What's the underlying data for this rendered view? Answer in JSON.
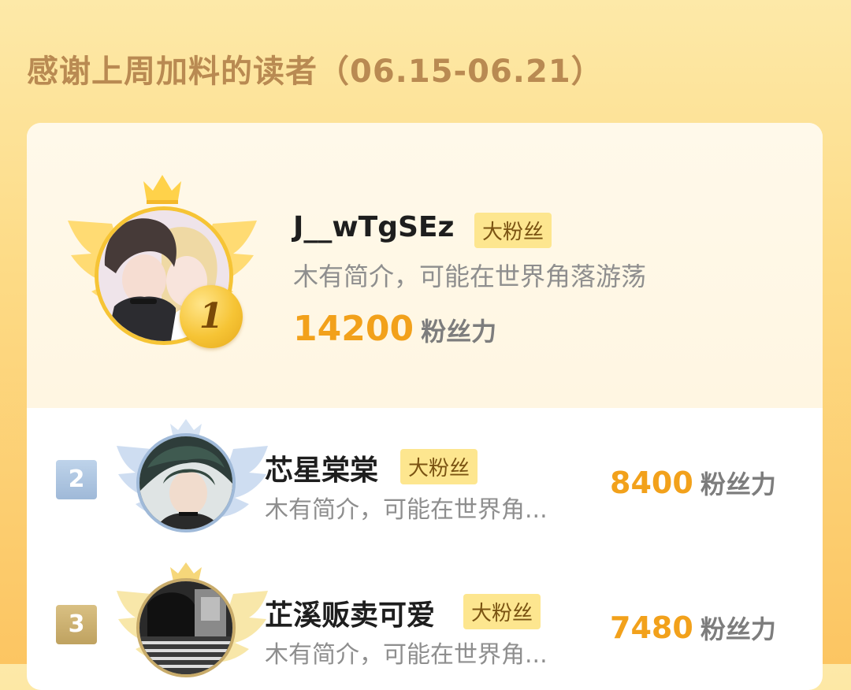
{
  "header": {
    "title": "感谢上周加料的读者（06.15-06.21）"
  },
  "colors": {
    "accent": "#f2a11b",
    "tag_bg": "#fde68f",
    "gold": "#f6c435",
    "silver": "#a9c3e0",
    "bronze": "#c8ab6a"
  },
  "readers": [
    {
      "rank": "1",
      "name": "J__wTgSEz",
      "tag": "大粉丝",
      "bio": "木有简介，可能在世界角落游荡",
      "score": "14200",
      "score_unit": "粉丝力"
    },
    {
      "rank": "2",
      "name": "芯星棠棠",
      "tag": "大粉丝",
      "bio": "木有简介，可能在世界角...",
      "score": "8400",
      "score_unit": "粉丝力"
    },
    {
      "rank": "3",
      "name": "芷溪贩卖可爱",
      "tag": "大粉丝",
      "bio": "木有简介，可能在世界角...",
      "score": "7480",
      "score_unit": "粉丝力"
    }
  ],
  "icons": {
    "crown": "crown-icon",
    "wings": "wings-icon",
    "rank_badge": "rank-badge-icon"
  }
}
